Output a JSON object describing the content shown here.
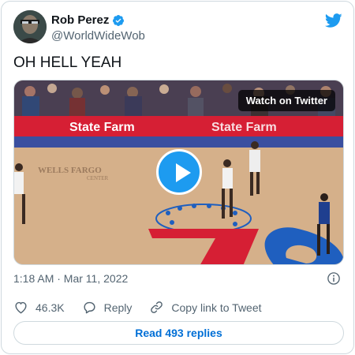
{
  "author": {
    "display_name": "Rob Perez",
    "handle": "@WorldWideWob",
    "verified": true
  },
  "tweet": {
    "text": "OH HELL YEAH",
    "timestamp": "1:18 AM · Mar 11, 2022"
  },
  "media": {
    "watch_label": "Watch on Twitter",
    "court_sign": "WELLS FARGO",
    "court_sign_sub": "CENTER",
    "banner_text": "State Farm"
  },
  "actions": {
    "likes": "46.3K",
    "reply_label": "Reply",
    "copy_link_label": "Copy link to Tweet"
  },
  "read_replies_label": "Read 493 replies",
  "colors": {
    "accent": "#1d9bf0",
    "link": "#006fd6",
    "muted": "#536471",
    "border": "#cfd9de",
    "court_red": "#d61f34",
    "court_blue": "#1f5fbf"
  }
}
